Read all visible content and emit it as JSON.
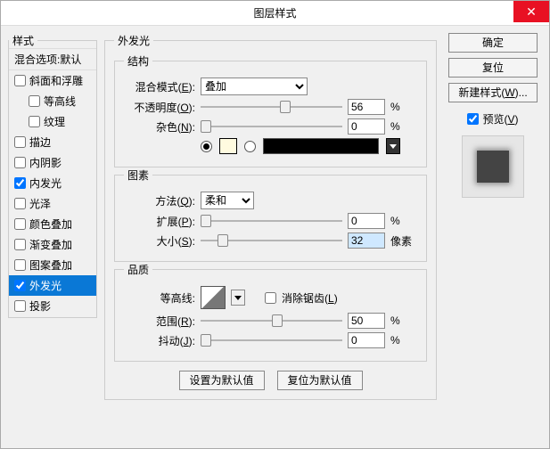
{
  "title": "图层样式",
  "sidebar_title": "样式",
  "blending_options": "混合选项:默认",
  "styles": [
    {
      "label": "斜面和浮雕",
      "checked": false,
      "selected": false,
      "sub": false
    },
    {
      "label": "等高线",
      "checked": false,
      "selected": false,
      "sub": true
    },
    {
      "label": "纹理",
      "checked": false,
      "selected": false,
      "sub": true
    },
    {
      "label": "描边",
      "checked": false,
      "selected": false,
      "sub": false
    },
    {
      "label": "内阴影",
      "checked": false,
      "selected": false,
      "sub": false
    },
    {
      "label": "内发光",
      "checked": true,
      "selected": false,
      "sub": false
    },
    {
      "label": "光泽",
      "checked": false,
      "selected": false,
      "sub": false
    },
    {
      "label": "颜色叠加",
      "checked": false,
      "selected": false,
      "sub": false
    },
    {
      "label": "渐变叠加",
      "checked": false,
      "selected": false,
      "sub": false
    },
    {
      "label": "图案叠加",
      "checked": false,
      "selected": false,
      "sub": false
    },
    {
      "label": "外发光",
      "checked": true,
      "selected": true,
      "sub": false
    },
    {
      "label": "投影",
      "checked": false,
      "selected": false,
      "sub": false
    }
  ],
  "panel": {
    "title": "外发光",
    "structure": {
      "legend": "结构",
      "blend_label_pre": "混合模式(",
      "blend_accel": "E",
      "blend_label_post": "):",
      "blend_value": "叠加",
      "opacity_label_pre": "不透明度(",
      "opacity_accel": "O",
      "opacity_label_post": "):",
      "opacity_value": "56",
      "opacity_unit": "%",
      "noise_label_pre": "杂色(",
      "noise_accel": "N",
      "noise_label_post": "):",
      "noise_value": "0",
      "noise_unit": "%"
    },
    "elements": {
      "legend": "图素",
      "tech_label_pre": "方法(",
      "tech_accel": "Q",
      "tech_label_post": "):",
      "tech_value": "柔和",
      "spread_label_pre": "扩展(",
      "spread_accel": "P",
      "spread_label_post": "):",
      "spread_value": "0",
      "spread_unit": "%",
      "size_label_pre": "大小(",
      "size_accel": "S",
      "size_label_post": "):",
      "size_value": "32",
      "size_unit": "像素"
    },
    "quality": {
      "legend": "品质",
      "contour_label": "等高线:",
      "antialias_pre": "消除锯齿(",
      "antialias_accel": "L",
      "antialias_post": ")",
      "range_label_pre": "范围(",
      "range_accel": "R",
      "range_label_post": "):",
      "range_value": "50",
      "range_unit": "%",
      "jitter_label_pre": "抖动(",
      "jitter_accel": "J",
      "jitter_label_post": "):",
      "jitter_value": "0",
      "jitter_unit": "%"
    },
    "defaults_set": "设置为默认值",
    "defaults_reset": "复位为默认值"
  },
  "right": {
    "ok": "确定",
    "reset": "复位",
    "newstyle_pre": "新建样式(",
    "newstyle_accel": "W",
    "newstyle_post": ")...",
    "preview_pre": "预览(",
    "preview_accel": "V",
    "preview_post": ")"
  }
}
